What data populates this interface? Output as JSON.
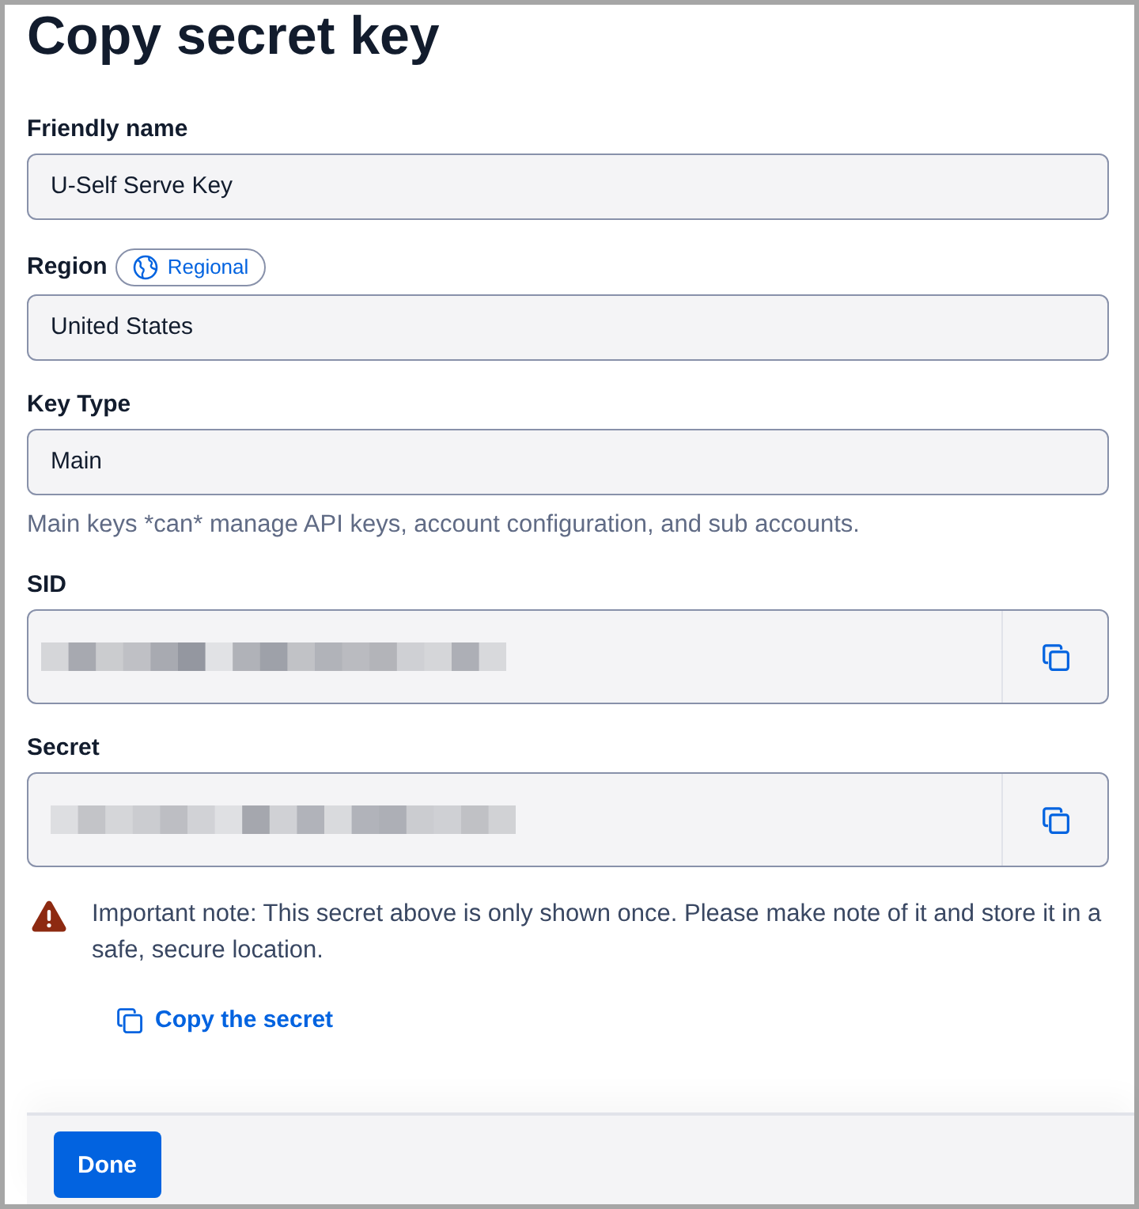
{
  "title": "Copy secret key",
  "fields": [
    {
      "kind": "text",
      "label": "Friendly name",
      "value": "U-Self Serve Key"
    },
    {
      "kind": "text",
      "label": "Region",
      "badge": "Regional",
      "value": "United States"
    },
    {
      "kind": "text",
      "label": "Key Type",
      "value": "Main",
      "help": "Main keys *can* manage API keys, account configuration, and sub accounts."
    },
    {
      "kind": "masked",
      "label": "SID"
    },
    {
      "kind": "masked",
      "label": "Secret"
    }
  ],
  "warning": {
    "text": "Important note: This secret above is only shown once. Please make note of it and store it in a safe, secure location."
  },
  "copy_link": {
    "label": "Copy the secret"
  },
  "footer": {
    "buttons": [
      "Done"
    ]
  }
}
